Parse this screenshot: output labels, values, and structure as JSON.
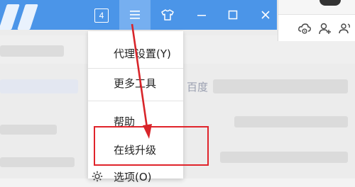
{
  "titlebar": {
    "tab_count": "4",
    "accent_color": "#4b95e8",
    "buttons": [
      "menu-icon",
      "skin-icon",
      "minimize-icon",
      "maximize-icon",
      "close-icon"
    ]
  },
  "right_panel": {
    "icons": [
      "cloud-sync-icon",
      "add-user-icon",
      "group-icon"
    ]
  },
  "menu": {
    "items": [
      {
        "label": "代理设置(Y)"
      },
      {
        "label": "更多工具"
      },
      {
        "label": "帮助"
      },
      {
        "label": "在线升级"
      },
      {
        "label": "选项(O)"
      }
    ]
  },
  "background": {
    "partial_text": "百度"
  },
  "annotation": {
    "highlight_color": "#e0242b",
    "arrow_color": "#e0242b"
  }
}
